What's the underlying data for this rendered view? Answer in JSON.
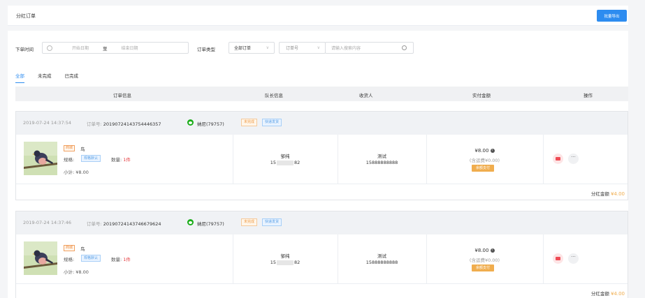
{
  "header": {
    "title": "分红订单",
    "export_label": "批量导出"
  },
  "filters": {
    "date_label": "下单时间",
    "date_start_placeholder": "开始日期",
    "date_separator": "至",
    "date_end_placeholder": "结束日期",
    "order_type_label": "订单类型",
    "order_type_value": "全部订单",
    "search_field_value": "订单号",
    "search_placeholder": "请输入搜索内容"
  },
  "tabs": [
    {
      "label": "全部",
      "active": true
    },
    {
      "label": "未完成",
      "active": false
    },
    {
      "label": "已完成",
      "active": false
    }
  ],
  "columns": [
    "订单信息",
    "队长信息",
    "收货人",
    "实付金额",
    "操作"
  ],
  "orders": [
    {
      "time": "2019-07-24 14:37:54",
      "order_no_label": "订单号:",
      "order_no": "20190724143754446357",
      "nickname": "纳尼(79757)",
      "status_tag": "未完成",
      "delivery_tag": "快递发货",
      "goods_tag": "商城",
      "goods_name": "鸟",
      "spec_label": "规格:",
      "spec_value": "规格默认",
      "qty_label": "数量:",
      "qty_value": "1件",
      "subtotal": "小计: ¥8.00",
      "leader_name": "邹纯",
      "leader_phone_prefix": "15",
      "leader_phone_suffix": "82",
      "receiver_name": "测试",
      "receiver_phone": "15888888888",
      "amount": "¥8.00",
      "shipping_note": "(含运费¥0.00)",
      "pay_method": "余额支付",
      "dividend_label": "分红金额",
      "dividend_amount": "¥4.00"
    },
    {
      "time": "2019-07-24 14:37:46",
      "order_no_label": "订单号:",
      "order_no": "20190724143746679624",
      "nickname": "纳尼(79757)",
      "status_tag": "未完成",
      "delivery_tag": "快递发货",
      "goods_tag": "商城",
      "goods_name": "鸟",
      "spec_label": "规格:",
      "spec_value": "规格默认",
      "qty_label": "数量:",
      "qty_value": "1件",
      "subtotal": "小计: ¥8.00",
      "leader_name": "邹纯",
      "leader_phone_prefix": "15",
      "leader_phone_suffix": "82",
      "receiver_name": "测试",
      "receiver_phone": "15888888888",
      "amount": "¥8.00",
      "shipping_note": "(含运费¥0.00)",
      "pay_method": "余额支付",
      "dividend_label": "分红金额",
      "dividend_amount": "¥4.00"
    }
  ],
  "colors": {
    "primary": "#2d8cf0",
    "warning": "#f0ad4e",
    "danger": "#ef4b55",
    "wechat": "#1aad19"
  }
}
